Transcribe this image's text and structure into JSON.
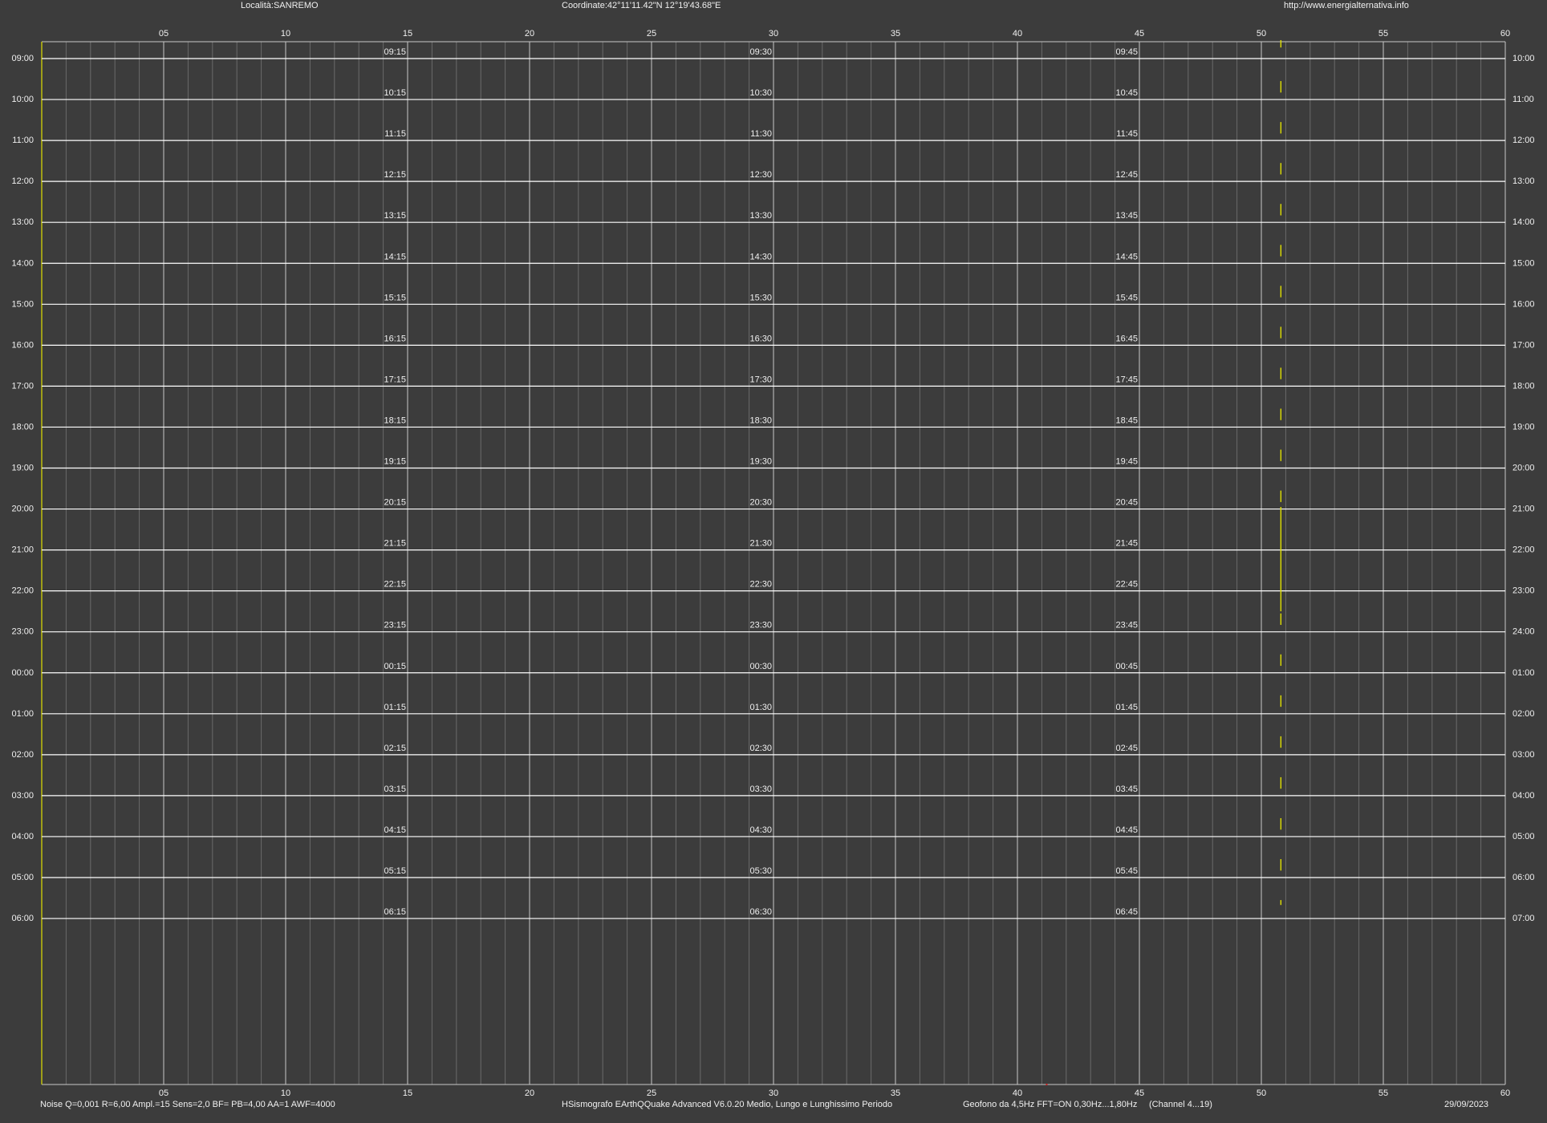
{
  "header": {
    "location": "Località:SANREMO",
    "coordinates": "Coordinate:42°11'11.42\"N  12°19'43.68\"E",
    "website": "http://www.energialternativa.info"
  },
  "footer": {
    "params": "Noise Q=0,001 R=6,00 Ampl.=15 Sens=2,0 BF= PB=4,00 AA=1 AWF=4000",
    "software": "HSismografo  EArthQQuake Advanced V6.0.20  Medio, Lungo e Lunghissimo Periodo",
    "sensor": "Geofono da 4,5Hz FFT=ON 0,30Hz...1,80Hz",
    "channel": "(Channel 4...19)",
    "date": "29/09/2023"
  },
  "colors": {
    "background": "#3c3c3c",
    "grid_major": "#c8c8c8",
    "grid_minor": "#6a6a6a",
    "hour_line": "#ffffff",
    "trace": "#e0e000"
  },
  "chart_data": {
    "type": "line",
    "x_axis": {
      "ticks": [
        "05",
        "10",
        "15",
        "20",
        "25",
        "30",
        "35",
        "40",
        "45",
        "50",
        "55",
        "60"
      ],
      "range": [
        0,
        60
      ],
      "unit": "minutes"
    },
    "rows_left_labels": [
      "09:00",
      "10:00",
      "11:00",
      "12:00",
      "13:00",
      "14:00",
      "15:00",
      "16:00",
      "17:00",
      "18:00",
      "19:00",
      "20:00",
      "21:00",
      "22:00",
      "23:00",
      "00:00",
      "01:00",
      "02:00",
      "03:00",
      "04:00",
      "05:00",
      "06:00"
    ],
    "rows_right_labels": [
      "10:00",
      "11:00",
      "12:00",
      "13:00",
      "14:00",
      "15:00",
      "16:00",
      "17:00",
      "18:00",
      "19:00",
      "20:00",
      "21:00",
      "22:00",
      "23:00",
      "24:00",
      "01:00",
      "02:00",
      "03:00",
      "04:00",
      "05:00",
      "06:00",
      "07:00"
    ],
    "row_quarter_labels": [
      [
        "09:15",
        "09:30",
        "09:45"
      ],
      [
        "10:15",
        "10:30",
        "10:45"
      ],
      [
        "11:15",
        "11:30",
        "11:45"
      ],
      [
        "12:15",
        "12:30",
        "12:45"
      ],
      [
        "13:15",
        "13:30",
        "13:45"
      ],
      [
        "14:15",
        "14:30",
        "14:45"
      ],
      [
        "15:15",
        "15:30",
        "15:45"
      ],
      [
        "16:15",
        "16:30",
        "16:45"
      ],
      [
        "17:15",
        "17:30",
        "17:45"
      ],
      [
        "18:15",
        "18:30",
        "18:45"
      ],
      [
        "19:15",
        "19:30",
        "19:45"
      ],
      [
        "20:15",
        "20:30",
        "20:45"
      ],
      [
        "21:15",
        "21:30",
        "21:45"
      ],
      [
        "22:15",
        "22:30",
        "22:45"
      ],
      [
        "23:15",
        "23:30",
        "23:45"
      ],
      [
        "00:15",
        "00:30",
        "00:45"
      ],
      [
        "01:15",
        "01:30",
        "01:45"
      ],
      [
        "02:15",
        "02:30",
        "02:45"
      ],
      [
        "03:15",
        "03:30",
        "03:45"
      ],
      [
        "04:15",
        "04:30",
        "04:45"
      ],
      [
        "05:15",
        "05:30",
        "05:45"
      ],
      [
        "06:15",
        "06:30",
        "06:45"
      ]
    ],
    "quarter_label_minutes": [
      15,
      30,
      45
    ],
    "trace_minute": 50.8,
    "trace_markers": [
      {
        "row": 0,
        "offset": -0.45,
        "length": 0.18
      },
      {
        "row": 0,
        "offset": 0.55,
        "length": 0.28
      },
      {
        "row": 1,
        "offset": 0.55,
        "length": 0.28
      },
      {
        "row": 2,
        "offset": 0.55,
        "length": 0.28
      },
      {
        "row": 3,
        "offset": 0.55,
        "length": 0.28
      },
      {
        "row": 4,
        "offset": 0.55,
        "length": 0.28
      },
      {
        "row": 5,
        "offset": 0.55,
        "length": 0.28
      },
      {
        "row": 6,
        "offset": 0.55,
        "length": 0.28
      },
      {
        "row": 7,
        "offset": 0.55,
        "length": 0.28
      },
      {
        "row": 8,
        "offset": 0.55,
        "length": 0.28
      },
      {
        "row": 9,
        "offset": 0.55,
        "length": 0.28
      },
      {
        "row": 10,
        "offset": 0.55,
        "length": 0.28
      },
      {
        "row": 11,
        "offset": -0.05,
        "length": 2.55
      },
      {
        "row": 13,
        "offset": 0.55,
        "length": 0.28
      },
      {
        "row": 14,
        "offset": 0.55,
        "length": 0.28
      },
      {
        "row": 15,
        "offset": 0.55,
        "length": 0.28
      },
      {
        "row": 16,
        "offset": 0.55,
        "length": 0.28
      },
      {
        "row": 17,
        "offset": 0.55,
        "length": 0.28
      },
      {
        "row": 18,
        "offset": 0.55,
        "length": 0.28
      },
      {
        "row": 19,
        "offset": 0.55,
        "length": 0.28
      },
      {
        "row": 20,
        "offset": 0.55,
        "length": 0.12
      }
    ]
  }
}
